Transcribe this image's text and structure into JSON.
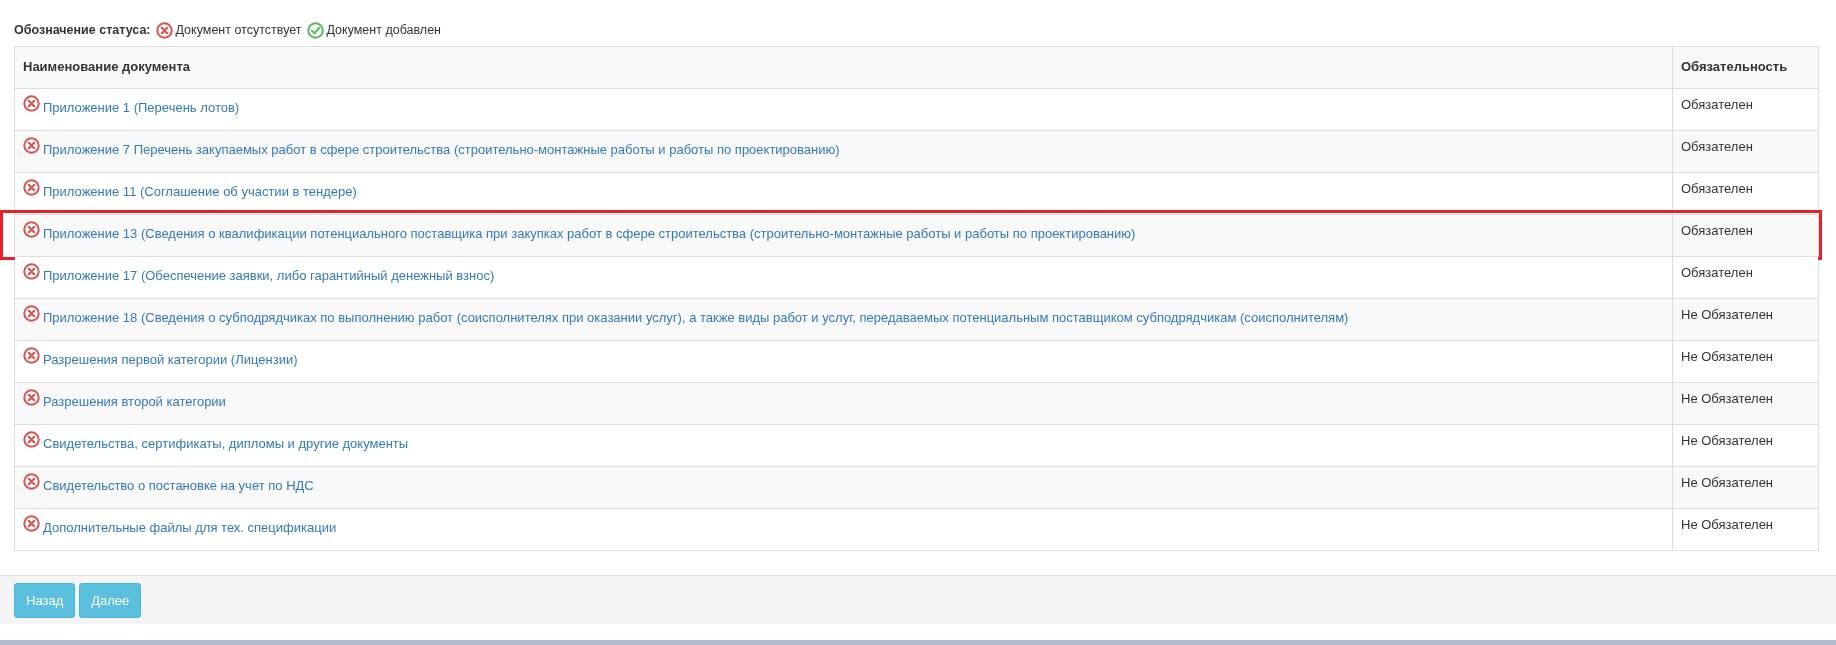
{
  "legend": {
    "title": "Обозначение статуса:",
    "items": [
      {
        "kind": "missing",
        "label": "Документ отсутствует"
      },
      {
        "kind": "added",
        "label": "Документ добавлен"
      }
    ]
  },
  "table": {
    "columns": [
      "Наименование документа",
      "Обязательность"
    ],
    "rows": [
      {
        "kind": "missing",
        "name": "Приложение 1 (Перечень лотов)",
        "requirement": "Обязателен",
        "highlighted": false
      },
      {
        "kind": "missing",
        "name": "Приложение 7 Перечень закупаемых работ в сфере строительства (строительно-монтажные работы и работы по проектированию)",
        "requirement": "Обязателен",
        "highlighted": false
      },
      {
        "kind": "missing",
        "name": "Приложение 11 (Соглашение об участии в тендере)",
        "requirement": "Обязателен",
        "highlighted": false
      },
      {
        "kind": "missing",
        "name": "Приложение 13 (Сведения о квалификации потенциального поставщика при закупках работ в сфере строительства (строительно-монтажные работы и работы по проектированию)",
        "requirement": "Обязателен",
        "highlighted": true
      },
      {
        "kind": "missing",
        "name": "Приложение 17 (Обеспечение заявки, либо гарантийный денежный взнос)",
        "requirement": "Обязателен",
        "highlighted": false
      },
      {
        "kind": "missing",
        "name": "Приложение 18 (Сведения о субподрядчиках по выполнению работ (соисполнителях при оказании услуг), а также виды работ и услуг, передаваемых потенциальным поставщиком субподрядчикам (соисполнителям)",
        "requirement": "Не Обязателен",
        "highlighted": false
      },
      {
        "kind": "missing",
        "name": "Разрешения первой категории (Лицензии)",
        "requirement": "Не Обязателен",
        "highlighted": false
      },
      {
        "kind": "missing",
        "name": "Разрешения второй категории",
        "requirement": "Не Обязателен",
        "highlighted": false
      },
      {
        "kind": "missing",
        "name": "Свидетельства, сертификаты, дипломы и другие документы",
        "requirement": "Не Обязателен",
        "highlighted": false
      },
      {
        "kind": "missing",
        "name": "Свидетельство о постановке на учет по НДС",
        "requirement": "Не Обязателен",
        "highlighted": false
      },
      {
        "kind": "missing",
        "name": "Дополнительные файлы для тех. спецификации",
        "requirement": "Не Обязателен",
        "highlighted": false
      }
    ]
  },
  "footer": {
    "buttons": [
      "Назад",
      "Далее"
    ]
  }
}
